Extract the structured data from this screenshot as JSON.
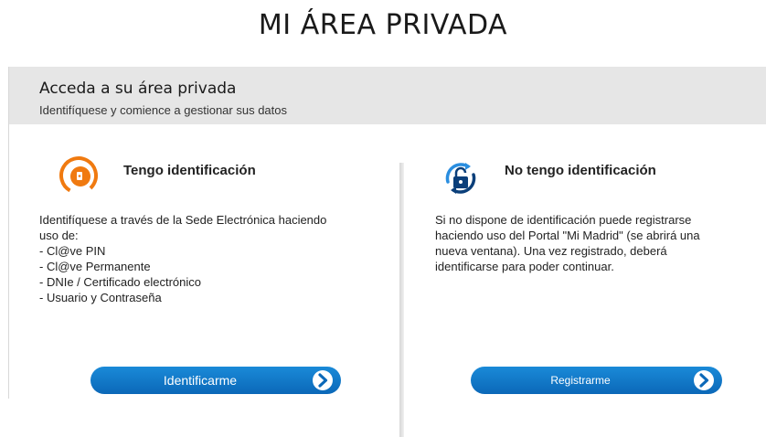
{
  "page": {
    "title": "MI ÁREA PRIVADA"
  },
  "header": {
    "title": "Acceda a su área privada",
    "subtitle": "Identifíquese y comience a gestionar sus datos"
  },
  "left": {
    "icon": "login-icon",
    "heading": "Tengo identificación",
    "lines": [
      "Identifíquese a través de la Sede Electrónica haciendo",
      "uso de:",
      "- Cl@ve PIN",
      "- Cl@ve Permanente",
      "- DNIe / Certificado electrónico",
      "- Usuario y Contraseña"
    ],
    "button_label": "Identificarme",
    "accent": "#f07a10"
  },
  "right": {
    "icon": "unlock-icon",
    "heading": "No tengo identificación",
    "lines": [
      "Si no dispone de identificación puede registrarse",
      "haciendo uso del Portal \"Mi Madrid\" (se abrirá una",
      "nueva ventana). Una vez registrado, deberá",
      "identificarse para poder continuar."
    ],
    "button_label": "Registrarme",
    "accent": "#0b68b8"
  },
  "colors": {
    "button": "#0b68b8",
    "header_bg": "#e6e6e6"
  }
}
